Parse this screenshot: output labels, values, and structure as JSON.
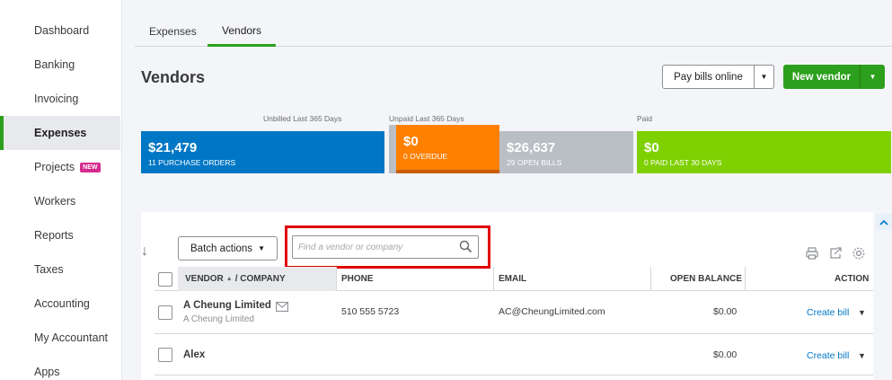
{
  "sidebar": {
    "items": [
      {
        "label": "Dashboard"
      },
      {
        "label": "Banking"
      },
      {
        "label": "Invoicing"
      },
      {
        "label": "Expenses",
        "active": true
      },
      {
        "label": "Projects",
        "badge": "NEW"
      },
      {
        "label": "Workers"
      },
      {
        "label": "Reports"
      },
      {
        "label": "Taxes"
      },
      {
        "label": "Accounting"
      },
      {
        "label": "My Accountant"
      },
      {
        "label": "Apps"
      }
    ]
  },
  "tabs": [
    {
      "label": "Expenses"
    },
    {
      "label": "Vendors",
      "active": true
    }
  ],
  "header": {
    "title": "Vendors",
    "pay_bills_label": "Pay bills online",
    "new_vendor_label": "New vendor"
  },
  "money_bar": {
    "unbilled_label": "Unbilled Last 365 Days",
    "unpaid_label": "Unpaid Last 365 Days",
    "paid_label": "Paid",
    "purchase_orders": {
      "amount": "$21,479",
      "caption": "11 PURCHASE ORDERS"
    },
    "overdue": {
      "amount": "$0",
      "caption": "0 OVERDUE"
    },
    "open_bills": {
      "amount": "$26,637",
      "caption": "29 OPEN BILLS"
    },
    "paid": {
      "amount": "$0",
      "caption": "0 PAID LAST 30 DAYS"
    }
  },
  "colors": {
    "green": "#2ca01c",
    "blue": "#0077c5",
    "orange": "#ff8000",
    "gray": "#babec5",
    "lime": "#7fd000",
    "highlight": "#e00000"
  },
  "toolbar": {
    "batch_actions_label": "Batch actions",
    "search_placeholder": "Find a vendor or company"
  },
  "table": {
    "headers": {
      "vendor": "VENDOR",
      "sort_indicator": "▲",
      "company": "/ COMPANY",
      "phone": "PHONE",
      "email": "EMAIL",
      "open_balance": "OPEN BALANCE",
      "action": "ACTION"
    },
    "rows": [
      {
        "vendor": "A Cheung Limited",
        "company": "A Cheung Limited",
        "phone": "510 555 5723",
        "email": "AC@CheungLimited.com",
        "open_balance": "$0.00",
        "action": "Create bill"
      },
      {
        "vendor": "Alex",
        "company": "",
        "phone": "",
        "email": "",
        "open_balance": "$0.00",
        "action": "Create bill"
      }
    ]
  }
}
